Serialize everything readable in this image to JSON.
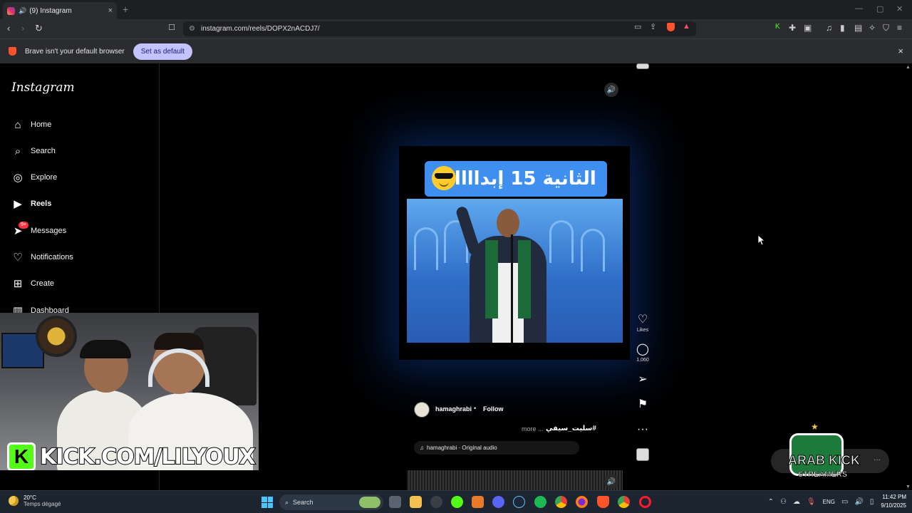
{
  "browser": {
    "tab_title": "(9) Instagram",
    "tab_close": "×",
    "new_tab": "+",
    "url": "instagram.com/reels/DOPX2nACDJ7/",
    "infobar_message": "Brave isn't your default browser",
    "set_default_label": "Set as default",
    "infobar_close": "×"
  },
  "instagram": {
    "logo": "Instagram",
    "nav": [
      {
        "label": "Home",
        "icon": "home-icon"
      },
      {
        "label": "Search",
        "icon": "search-icon"
      },
      {
        "label": "Explore",
        "icon": "compass-icon"
      },
      {
        "label": "Reels",
        "icon": "reels-icon"
      },
      {
        "label": "Messages",
        "icon": "messenger-icon",
        "badge": "9+"
      },
      {
        "label": "Notifications",
        "icon": "heart-icon"
      },
      {
        "label": "Create",
        "icon": "plus-square-icon"
      },
      {
        "label": "Dashboard",
        "icon": "chart-icon"
      }
    ],
    "reel": {
      "caption_banner": "الثانية 15 إبداااااع",
      "author": "hamaghrabi",
      "separator": "•",
      "follow_label": "Follow",
      "caption_tag": "#سليت_سيفي",
      "caption_more": "more ...",
      "audio": "hamaghrabi · Original audio",
      "likes_label": "Likes",
      "comments_count": "1,060"
    }
  },
  "stream": {
    "kick_letter": "K",
    "kick_url": "KICK.COM/LILYOUX",
    "logo_line1": "ARAB KICK",
    "logo_line2": "STREAMERS"
  },
  "taskbar": {
    "temperature": "20°C",
    "weather": "Temps dégagé",
    "search_label": "Search",
    "language": "ENG",
    "time": "11:42 PM",
    "date": "9/10/2025"
  }
}
